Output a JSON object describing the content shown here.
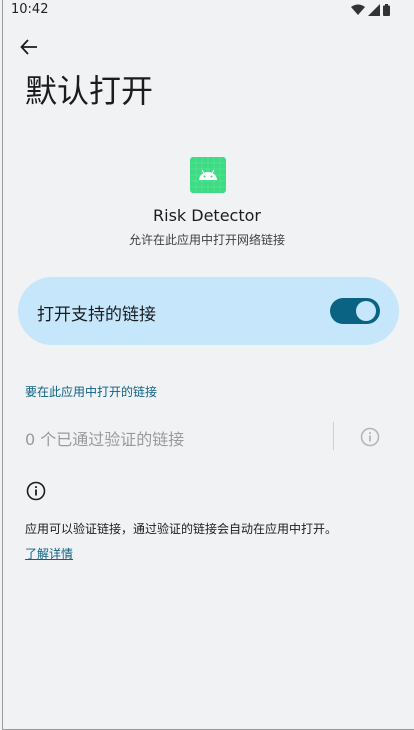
{
  "status_bar": {
    "time": "10:42"
  },
  "header": {
    "title": "默认打开"
  },
  "app": {
    "name": "Risk Detector",
    "description": "允许在此应用中打开网络链接"
  },
  "toggle": {
    "label": "打开支持的链接",
    "on": true
  },
  "links_section": {
    "header": "要在此应用中打开的链接",
    "verified_label": "0 个已通过验证的链接"
  },
  "info": {
    "text": "应用可以验证链接，通过验证的链接会自动在应用中打开。",
    "learn_more": "了解详情"
  },
  "colors": {
    "accent": "#0b6384",
    "card_bg": "#c5e6fb",
    "android_green": "#3ddc84"
  }
}
